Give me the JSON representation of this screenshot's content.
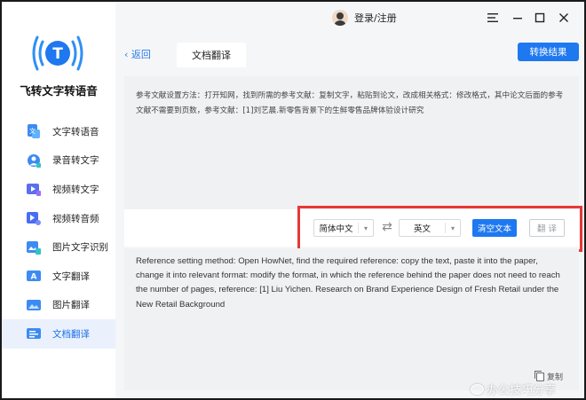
{
  "app": {
    "title": "飞转文字转语音",
    "accent_color": "#1e78f0",
    "logo_letter": "T",
    "logo_icon": "tts-logo-icon"
  },
  "sidebar": {
    "items": [
      {
        "label": "文字转语音",
        "icon": "text-to-speech-icon",
        "active": false
      },
      {
        "label": "录音转文字",
        "icon": "recording-to-text-icon",
        "active": false
      },
      {
        "label": "视频转文字",
        "icon": "video-to-text-icon",
        "active": false
      },
      {
        "label": "视频转音频",
        "icon": "video-to-audio-icon",
        "active": false
      },
      {
        "label": "图片文字识别",
        "icon": "image-ocr-icon",
        "active": false
      },
      {
        "label": "文字翻译",
        "icon": "text-translate-icon",
        "active": false
      },
      {
        "label": "图片翻译",
        "icon": "image-translate-icon",
        "active": false
      },
      {
        "label": "文档翻译",
        "icon": "document-translate-icon",
        "active": true
      }
    ]
  },
  "titlebar": {
    "user_label": "登录/注册",
    "menu_icon": "menu-icon",
    "minimize_icon": "minimize-icon",
    "maximize_icon": "maximize-icon",
    "close_icon": "close-icon"
  },
  "main": {
    "back_label": "‹ 返回",
    "tab_label": "文档翻译",
    "convert_button": "转换结果",
    "source_text": "参考文献设置方法：打开知网，找到所需的参考文献：复制文字，粘贴到论文，改成相关格式：修改格式，其中论文后面的参考文献不需要到页数，参考文献：[1]刘艺晨.新零售背景下的生鲜零售品牌体验设计研究",
    "source_lang": "简体中文",
    "target_lang": "英文",
    "swap_icon": "swap-icon",
    "clear_button": "清空文本",
    "translate_button": "翻 译",
    "result_text": "Reference setting method: Open HowNet, find the required reference: copy the text, paste it into the paper, change it into relevant format: modify the format, in which the reference behind the paper does not need to reach the number of pages, reference: [1] Liu Yichen. Research on Brand Experience Design of Fresh Retail under the New Retail Background",
    "copy_label": "复制"
  },
  "watermark": {
    "text": "办公技巧分享"
  }
}
